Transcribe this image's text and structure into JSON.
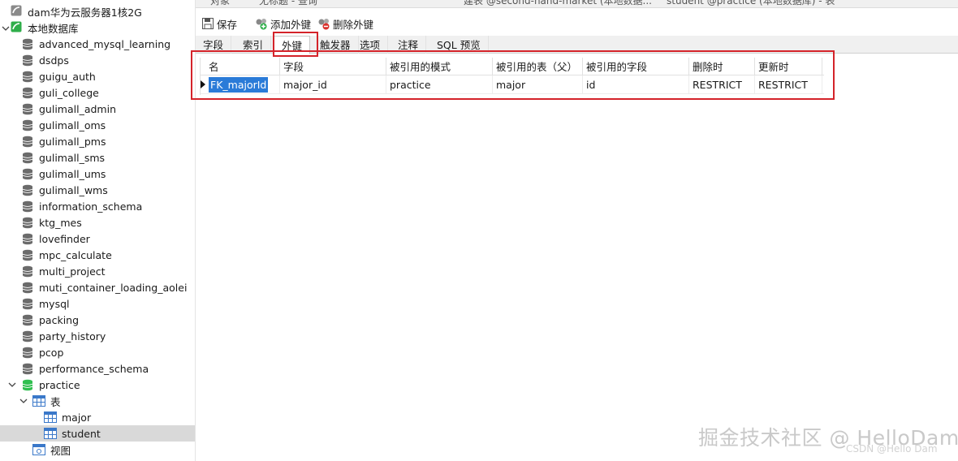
{
  "navigator": {
    "connection_cloud": "dam华为云服务器1核2G",
    "connection_local": "本地数据库",
    "databases": [
      "advanced_mysql_learning",
      "dsdps",
      "guigu_auth",
      "guli_college",
      "gulimall_admin",
      "gulimall_oms",
      "gulimall_pms",
      "gulimall_sms",
      "gulimall_ums",
      "gulimall_wms",
      "information_schema",
      "ktg_mes",
      "lovefinder",
      "mpc_calculate",
      "multi_project",
      "muti_container_loading_aolei",
      "mysql",
      "packing",
      "party_history",
      "pcop",
      "performance_schema",
      "practice"
    ],
    "tables_folder": "表",
    "tables": [
      "major",
      "student"
    ],
    "views_folder": "视图",
    "selected_table": "student"
  },
  "doc_tabs": {
    "tab1": "对象",
    "tab2": "无标题 - 查询",
    "tab3": "建表 @second-hand-market (本地数据...",
    "tab4": "student @practice (本地数据库) - 表"
  },
  "toolbar": {
    "save_label": "保存",
    "add_fk_label": "添加外键",
    "delete_fk_label": "删除外键"
  },
  "subtabs": [
    "字段",
    "索引",
    "外键",
    "触发器",
    "选项",
    "注释",
    "SQL 预览"
  ],
  "active_subtab": "外键",
  "grid": {
    "columns": [
      "名",
      "字段",
      "被引用的模式",
      "被引用的表（父）",
      "被引用的字段",
      "删除时",
      "更新时"
    ],
    "rows": [
      {
        "name": "FK_majorId",
        "field": "major_id",
        "ref_schema": "practice",
        "ref_table": "major",
        "ref_field": "id",
        "on_delete": "RESTRICT",
        "on_update": "RESTRICT"
      }
    ]
  },
  "watermark": {
    "main": "掘金技术社区 @ HelloDam",
    "sub": "CSDN @Hello Dam"
  },
  "colors": {
    "highlight_red": "#d4232a",
    "selection_blue": "#2a7bd8",
    "db_icon_green": "#2fbf4f",
    "db_icon_gray": "#6b6b6b"
  }
}
